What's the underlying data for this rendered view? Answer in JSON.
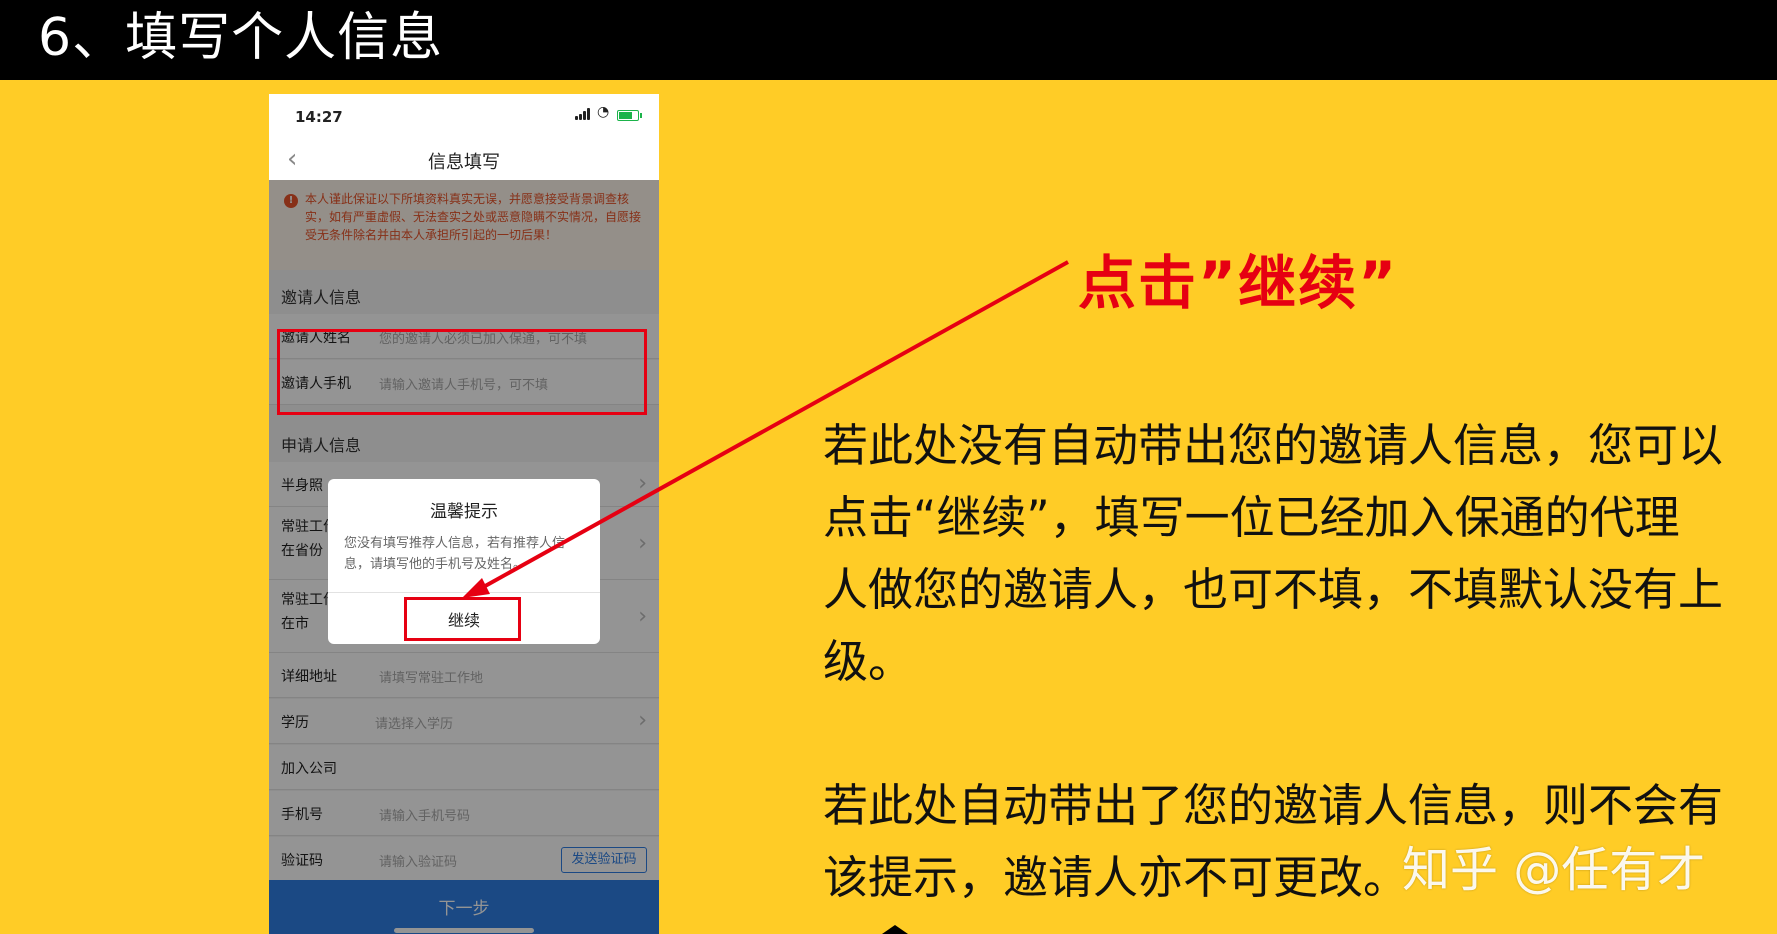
{
  "slide": {
    "title": "6、填写个人信息",
    "callout": "点击”继续”",
    "paragraph1": "若此处没有自动带出您的邀请人信息，您可以点击“继续”，填写一位已经加入保通的代理人做您的邀请人，也可不填，不填默认没有上级。",
    "paragraph2": "若此处自动带出了您的邀请人信息，则不会有该提示，邀请人亦不可更改。",
    "watermark": "知乎 @任有才",
    "colors": {
      "background": "#ffcc26",
      "accent_red": "#e60012",
      "primary_blue": "#2f7ee3"
    }
  },
  "phone": {
    "status": {
      "time": "14:27"
    },
    "nav": {
      "title": "信息填写",
      "back_icon": "chevron-left-icon"
    },
    "warning": "本人谨此保证以下所填资料真实无误，并愿意接受背景调查核实，如有严重虚假、无法查实之处或恶意隐瞒不实情况，自愿接受无条件除名并由本人承担所引起的一切后果！",
    "inviter_section": {
      "title": "邀请人信息",
      "fields": [
        {
          "label": "邀请人姓名",
          "placeholder": "您的邀请人必须已加入保通，可不填"
        },
        {
          "label": "邀请人手机",
          "placeholder": "请输入邀请人手机号，可不填"
        }
      ]
    },
    "applicant_section": {
      "title": "申请人信息",
      "rows": [
        {
          "label": "半身照"
        },
        {
          "label": "常驻工作",
          "label2": "在省份"
        },
        {
          "label": "常驻工作",
          "label2": "在市"
        },
        {
          "label": "详细地址",
          "placeholder": "请填写常驻工作地"
        },
        {
          "label": "学历",
          "placeholder": "请选择入学历"
        },
        {
          "label": "加入公司"
        },
        {
          "label": "手机号",
          "placeholder": "请输入手机号码"
        },
        {
          "label": "验证码",
          "placeholder": "请输入验证码",
          "button": "发送验证码"
        }
      ]
    },
    "next_button": "下一步",
    "dialog": {
      "title": "温馨提示",
      "message": "您没有填写推荐人信息，若有推荐人信息，请填写他的手机号及姓名。",
      "button": "继续"
    }
  }
}
